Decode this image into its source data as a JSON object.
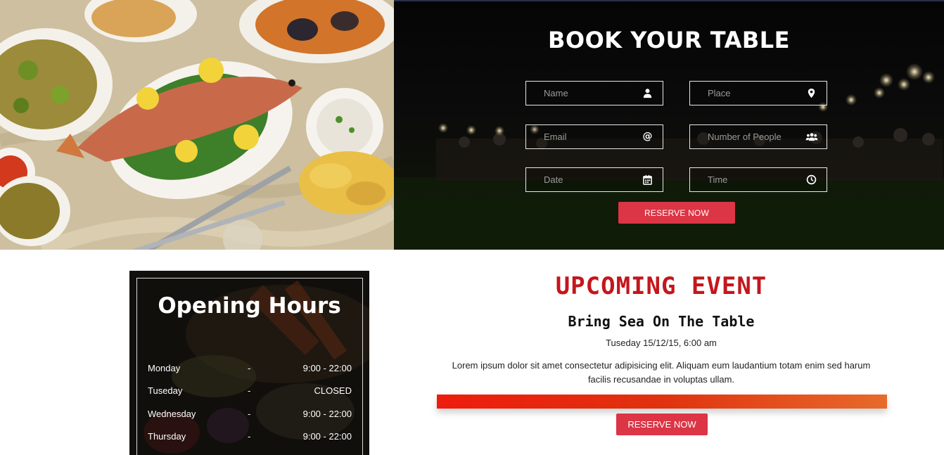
{
  "booking": {
    "title": "BOOK YOUR TABLE",
    "fields": {
      "name": {
        "placeholder": "Name",
        "icon": "user-icon"
      },
      "place": {
        "placeholder": "Place",
        "icon": "map-pin-icon"
      },
      "email": {
        "placeholder": "Email",
        "icon": "at-icon"
      },
      "people": {
        "placeholder": "Number of People",
        "icon": "users-icon"
      },
      "date": {
        "placeholder": "Date",
        "icon": "calendar-icon"
      },
      "time": {
        "placeholder": "Time",
        "icon": "clock-icon"
      }
    },
    "reserve_label": "RESERVE NOW"
  },
  "hours": {
    "title": "Opening Hours",
    "rows": [
      {
        "day": "Monday",
        "dash": "-",
        "time": "9:00 - 22:00"
      },
      {
        "day": "Tuseday",
        "dash": "-",
        "time": "CLOSED"
      },
      {
        "day": "Wednesday",
        "dash": "-",
        "time": "9:00 - 22:00"
      },
      {
        "day": "Thursday",
        "dash": "-",
        "time": "9:00 - 22:00"
      }
    ]
  },
  "event": {
    "title": "UPCOMING EVENT",
    "name": "Bring Sea On The Table",
    "date": "Tuseday 15/12/15, 6:00 am",
    "description": "Lorem ipsum dolor sit amet consectetur adipisicing elit. Aliquam eum laudantium totam enim sed harum facilis recusandae in voluptas ullam.",
    "reserve_label": "RESERVE NOW"
  },
  "colors": {
    "accent": "#dc3545",
    "event_title": "#c4161c",
    "bar_start": "#ee1c0e",
    "bar_end": "#e86a2b"
  }
}
